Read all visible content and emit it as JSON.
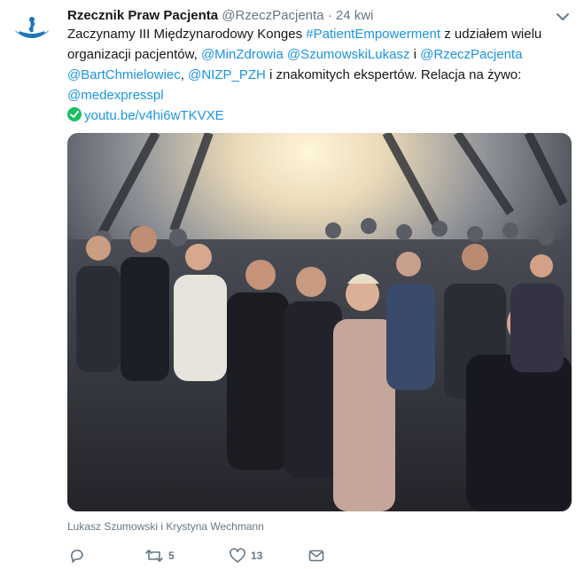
{
  "tweet": {
    "author_name": "Rzecznik Praw Pacjenta",
    "author_handle": "@RzeczPacjenta",
    "separator": "·",
    "timestamp": "24 kwi",
    "text": {
      "part1": "Zaczynamy III Międzynarodowy Konges ",
      "hashtag": "#PatientEmpowerment",
      "part2": " z udziałem wielu organizacji pacjentów, ",
      "mention1": "@MinZdrowia",
      "mention2": "@SzumowskiLukasz",
      "part3": " i ",
      "mention3": "@RzeczPacjenta",
      "mention4": "@BartChmielowiec",
      "sep_comma": ", ",
      "mention5": "@NIZP_PZH",
      "part4": " i znakomitych ekspertów. Relacja na żywo: ",
      "mention6": "@medexpresspl",
      "url": "youtu.be/v4hi6wTKVXE"
    },
    "photo_caption": "Lukasz Szumowski i Krystyna Wechmann",
    "actions": {
      "reply_count": "",
      "retweet_count": "5",
      "like_count": "13"
    }
  },
  "icons": [
    "logo-icon",
    "chevron-down-icon",
    "check-icon",
    "reply-icon",
    "retweet-icon",
    "like-icon",
    "message-icon"
  ],
  "colors": {
    "link": "#1b95e0",
    "muted": "#657786",
    "check": "#17bf63",
    "logo": "#1a73b8"
  }
}
